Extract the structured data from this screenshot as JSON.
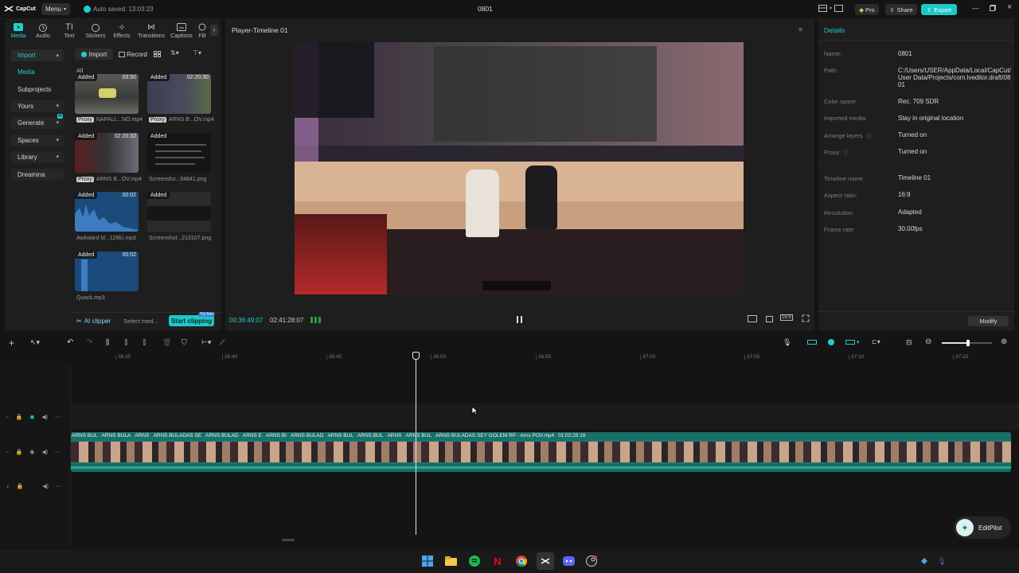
{
  "app": {
    "logo_text": "CapCut",
    "menu_label": "Menu",
    "autosave": "Auto saved: 13:03:23",
    "window_title": "0801",
    "pro_label": "Pro",
    "share_label": "Share",
    "export_label": "Export"
  },
  "toolbar": {
    "items": [
      {
        "label": "Media",
        "icon": "media-icon"
      },
      {
        "label": "Audio",
        "icon": "audio-icon"
      },
      {
        "label": "Text",
        "icon": "text-icon"
      },
      {
        "label": "Stickers",
        "icon": "stickers-icon"
      },
      {
        "label": "Effects",
        "icon": "effects-icon"
      },
      {
        "label": "Transitions",
        "icon": "transitions-icon"
      },
      {
        "label": "Captions",
        "icon": "captions-icon"
      },
      {
        "label": "Filt",
        "icon": "filters-icon"
      }
    ],
    "active": "Media"
  },
  "sidebar": {
    "items": [
      {
        "label": "Import"
      },
      {
        "label": "Media"
      },
      {
        "label": "Subprojects"
      },
      {
        "label": "Yours"
      },
      {
        "label": "Generate",
        "badge": "AI"
      },
      {
        "label": "Spaces"
      },
      {
        "label": "Library"
      },
      {
        "label": "Dreamina"
      }
    ]
  },
  "media_toolbar": {
    "import_label": "Import",
    "record_label": "Record",
    "filter_all": "All"
  },
  "media_items": [
    {
      "added": "Added",
      "duration": "03:50",
      "proxy": "Proxy",
      "name": "NAPALL...NO.mp4"
    },
    {
      "added": "Added",
      "duration": "02:20:30",
      "proxy": "Proxy",
      "name": "ARNS B...OV.mp4"
    },
    {
      "added": "Added",
      "duration": "02:20:32",
      "proxy": "Proxy",
      "name": "ARNS B...OV.mp4"
    },
    {
      "added": "Added",
      "duration": "",
      "proxy": "",
      "name": "Screensho...94841.png"
    },
    {
      "added": "Added",
      "duration": "00:02",
      "proxy": "",
      "name": "Awkward M...128k).mp3"
    },
    {
      "added": "Added",
      "duration": "",
      "proxy": "",
      "name": "Screenshot...213107.png"
    },
    {
      "added": "Added",
      "duration": "00:02",
      "proxy": "",
      "name": "Quack.mp3"
    }
  ],
  "media_footer": {
    "ai_clipper": "AI clipper",
    "select_media": "Select med...",
    "start_clipping": "Start clipping",
    "try_free": "Try free"
  },
  "player": {
    "title": "Player-Timeline 01",
    "current_time": "00:36:49:07",
    "total_time": "02:41:28:07",
    "ratio_label": "16:9"
  },
  "details": {
    "header": "Details",
    "rows": [
      {
        "label": "Name:",
        "value": "0801"
      },
      {
        "label": "Path:",
        "value": "C:/Users/USER/AppData/Local/CapCut/User Data/Projects/com.lveditor.draft/0801"
      },
      {
        "label": "Color space",
        "value": "Rec. 709 SDR"
      },
      {
        "label": "Imported media:",
        "value": "Stay in original location"
      },
      {
        "label": "Arrange layers",
        "value": "Turned on"
      },
      {
        "label": "Proxy:",
        "value": "Turned on"
      },
      {
        "label": "Timeline name",
        "value": "Timeline 01"
      },
      {
        "label": "Aspect ratio:",
        "value": "16:9"
      },
      {
        "label": "Resolution:",
        "value": "Adapted"
      },
      {
        "label": "Frame rate:",
        "value": "30.00fps"
      }
    ],
    "modify_label": "Modify"
  },
  "timeline": {
    "ruler": [
      "36:35",
      "36:40",
      "36:45",
      "36:50",
      "36:55",
      "37:00",
      "37:05",
      "37:10",
      "37:15"
    ],
    "clip_segments": [
      "ARNS BUL",
      "ARNS BULA",
      "ARNS",
      "ARNS BULADAS SE",
      "ARNS BULAD",
      "ARNS E",
      "ARNS BI",
      "ARNS BULAD",
      "ARNS BUL",
      "ARNS BUL",
      "ARNS",
      "ARNS BUL"
    ],
    "main_clip_label": "ARNS BULADAS SEY GOLEM RP - Arns POV.mp4",
    "main_clip_duration": "01:02:29:16",
    "editpilot_label": "EditPilot"
  },
  "colors": {
    "accent": "#1fd0cf",
    "clip": "#1e7f76",
    "export": "#1ec8c8"
  }
}
